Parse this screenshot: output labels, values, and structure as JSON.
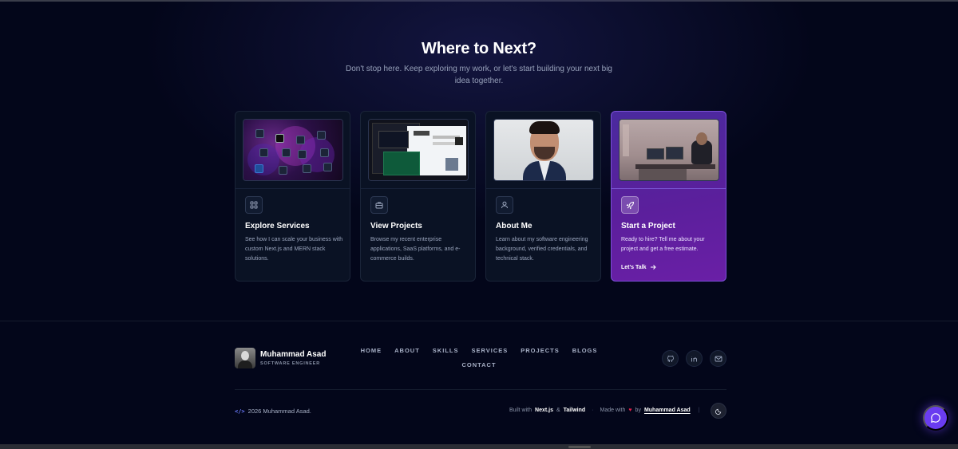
{
  "hero": {
    "title": "Where to Next?",
    "subtitle": "Don't stop here. Keep exploring my work, or let's start building your next big idea together."
  },
  "cards": [
    {
      "title": "Explore Services",
      "description": "See how I can scale your business with custom Next.js and MERN stack solutions.",
      "icon": "grid-icon",
      "image": "tech-stack-logos-image"
    },
    {
      "title": "View Projects",
      "description": "Browse my recent enterprise applications, SaaS platforms, and e-commerce builds.",
      "icon": "briefcase-icon",
      "image": "project-screenshots-image"
    },
    {
      "title": "About Me",
      "description": "Learn about my software engineering background, verified credentials, and technical stack.",
      "icon": "user-icon",
      "image": "portrait-photo"
    },
    {
      "title": "Start a Project",
      "description": "Ready to hire? Tell me about your project and get a free estimate.",
      "cta": "Let's Talk",
      "icon": "rocket-icon",
      "image": "workspace-photo"
    }
  ],
  "footer": {
    "brand_name": "Muhammad Asad",
    "brand_role": "SOFTWARE ENGINEER",
    "nav": [
      "HOME",
      "ABOUT",
      "SKILLS",
      "SERVICES",
      "PROJECTS",
      "BLOGS",
      "CONTACT"
    ],
    "social": [
      "github-icon",
      "linkedin-icon",
      "mail-icon"
    ],
    "copyright_code": "</>",
    "copyright": "2026 Muhammad Asad.",
    "built_with": "Built with",
    "tech1": "Next.js",
    "and": "&",
    "tech2": "Tailwind",
    "made_with": "Made with",
    "by": "by",
    "author": "Muhammad Asad"
  },
  "colors": {
    "background": "#03061a",
    "accent": "#6a3cf0",
    "card_highlight": "#5b1f9c",
    "heart": "#e0224a"
  }
}
